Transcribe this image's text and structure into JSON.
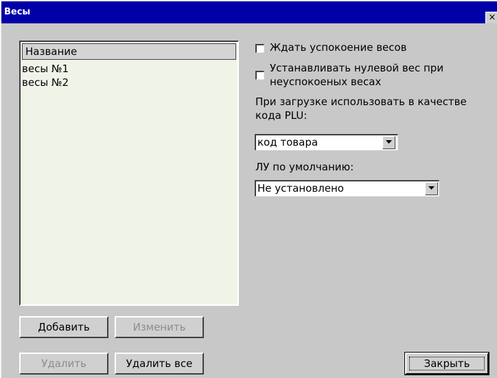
{
  "window": {
    "title": "Весы",
    "close_label": "×"
  },
  "scales_list": {
    "header": "Название",
    "items": [
      "весы №1",
      "весы №2"
    ]
  },
  "options": {
    "wait_stable_label": "Ждать успокоение весов",
    "wait_stable_checked": false,
    "zero_weight_label_line1": "Устанавливать нулевой вес при",
    "zero_weight_label_line2": "неуспокоеных весах",
    "zero_weight_checked": false,
    "plu_code_label_line1": "При загрузке использовать в качестве",
    "plu_code_label_line2": "кода PLU:",
    "plu_code_value": "код товара",
    "default_lu_label": "ЛУ по умолчанию:",
    "default_lu_value": "Не установлено"
  },
  "buttons": {
    "add": "Добавить",
    "edit": "Изменить",
    "delete": "Удалить",
    "delete_all": "Удалить все",
    "close": "Закрыть"
  },
  "icons": {
    "close": "close-icon",
    "dropdown": "chevron-down-icon"
  },
  "colors": {
    "titlebar": "#0000a8",
    "window_bg": "#c8c8c8",
    "list_bg": "#f0f4e8",
    "disabled_text": "#8c8c8c"
  }
}
